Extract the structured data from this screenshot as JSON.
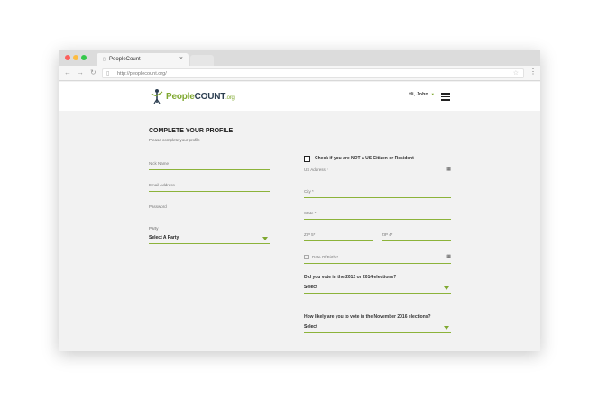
{
  "browser": {
    "tab_title": "PeopleCount",
    "tab_close": "×",
    "url": "http://peoplecount.org/",
    "back": "←",
    "forward": "→",
    "reload": "↻",
    "star": "☆",
    "menu": "⋮"
  },
  "header": {
    "logo_people": "People",
    "logo_count": "COUNT",
    "logo_org": ".org",
    "user_greeting": "Hi, John",
    "user_caret": "▼"
  },
  "form": {
    "title": "COMPLETE YOUR PROFILE",
    "subtitle": "Please complete your profile",
    "left_fields": {
      "nick_name": "Nick Name",
      "email": "Email Address",
      "password": "Password"
    },
    "party_label": "Party",
    "party_value": "Select A Party",
    "not_us_citizen_label": "Check if you are NOT a US Citizen or Resident",
    "right_fields": {
      "us_address": "US Address *",
      "city": "City *",
      "state": "State *",
      "zip5": "ZIP 5*",
      "zip4": "ZIP 4*",
      "dob": "Date Of Birth *"
    },
    "question_2012": "Did you vote in the 2012 or 2014 elections?",
    "question_2012_value": "Select",
    "question_2016": "How likely are you to vote in the November 2016 elections?",
    "question_2016_value": "Select",
    "calendar_glyph": "▦"
  },
  "colors": {
    "accent": "#7fa830",
    "logo_dark": "#2c3e50",
    "page_bg": "#f2f2f2"
  },
  "icons": [
    "page-icon",
    "star-icon",
    "menu-dots-icon",
    "logo-figure-icon",
    "caret-down-icon",
    "hamburger-icon",
    "calendar-icon",
    "dropdown-triangle-icon"
  ]
}
